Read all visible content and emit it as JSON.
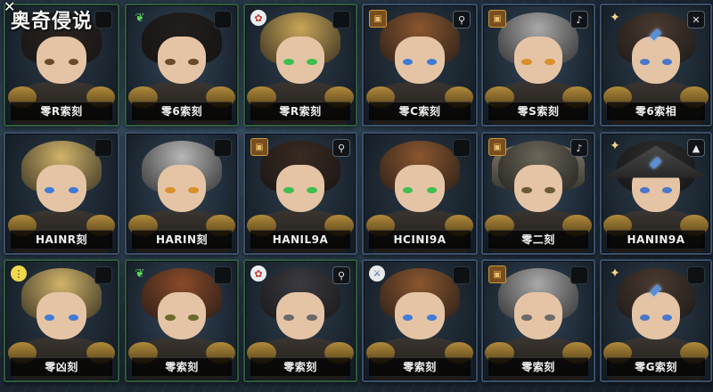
{
  "title": "奥奇侵说",
  "colors": {
    "accent": "#f0f0f0",
    "bg": "#1b2530"
  },
  "cards": [
    {
      "name": "零R索刻",
      "corner": "",
      "badge": "",
      "hair": "#2b2420",
      "eyes": "#6b4a2c",
      "type": "plain",
      "border": "green"
    },
    {
      "name": "零6索刻",
      "corner": "leaf",
      "badge": "",
      "hair": "#221e1c",
      "eyes": "#6b4a2c",
      "type": "plain",
      "border": "green"
    },
    {
      "name": "零R索刻",
      "corner": "medal",
      "badge": "",
      "hair": "#c9a658",
      "eyes": "#3fbf4f",
      "type": "plain",
      "border": "green"
    },
    {
      "name": "零C索刻",
      "corner": "chest",
      "badge": "⚲",
      "hair": "#8a5630",
      "eyes": "#3f7bd6",
      "type": "plain",
      "border": "blue"
    },
    {
      "name": "零S索刻",
      "corner": "chest",
      "badge": "♪",
      "hair": "#a9a9a9",
      "eyes": "#d9902c",
      "type": "plain",
      "border": "blue"
    },
    {
      "name": "零6索相",
      "corner": "star",
      "badge": "✕",
      "hair": "#4a3a30",
      "eyes": "#4a78c8",
      "type": "gem",
      "border": "blue"
    },
    {
      "name": "HAINR刻",
      "corner": "",
      "badge": "",
      "hair": "#d1b46a",
      "eyes": "#3f7bd6",
      "type": "plain",
      "border": "blue"
    },
    {
      "name": "HARIN刻",
      "corner": "",
      "badge": "",
      "hair": "#b6b6b6",
      "eyes": "#d9902c",
      "type": "plain",
      "border": "blue"
    },
    {
      "name": "HANIL9A",
      "corner": "chest",
      "badge": "⚲",
      "hair": "#3a2a22",
      "eyes": "#3fbf4f",
      "type": "plain",
      "border": "blue"
    },
    {
      "name": "HCINI9A",
      "corner": "",
      "badge": "",
      "hair": "#8a5630",
      "eyes": "#3fbf4f",
      "type": "plain",
      "border": "blue"
    },
    {
      "name": "零二刻",
      "corner": "chest",
      "badge": "♪",
      "hair": "#6a6658",
      "eyes": "#6a5a3a",
      "type": "helm",
      "border": "blue"
    },
    {
      "name": "HANIN9A",
      "corner": "star",
      "badge": "▲",
      "hair": "#2c2c2c",
      "eyes": "#4a78c8",
      "type": "hat",
      "border": "blue"
    },
    {
      "name": "零凶刻",
      "corner": "warn",
      "badge": "",
      "hair": "#d1b46a",
      "eyes": "#3f7bd6",
      "type": "plain",
      "border": "green"
    },
    {
      "name": "零索刻",
      "corner": "leaf",
      "badge": "",
      "hair": "#8a4a2a",
      "eyes": "#6b6a2c",
      "type": "plain",
      "border": "green"
    },
    {
      "name": "零索刻",
      "corner": "medal",
      "badge": "⚲",
      "hair": "#3a3a40",
      "eyes": "#6b6a6a",
      "type": "plain",
      "border": "green"
    },
    {
      "name": "零索刻",
      "corner": "shield",
      "badge": "",
      "hair": "#8a5630",
      "eyes": "#3f7bd6",
      "type": "plain",
      "border": "blue"
    },
    {
      "name": "零索刻",
      "corner": "chest",
      "badge": "",
      "hair": "#a9a9a9",
      "eyes": "#6a6a6a",
      "type": "plain",
      "border": "blue"
    },
    {
      "name": "零G索刻",
      "corner": "star",
      "badge": "",
      "hair": "#4a3a30",
      "eyes": "#4a78c8",
      "type": "gem",
      "border": "blue"
    }
  ]
}
